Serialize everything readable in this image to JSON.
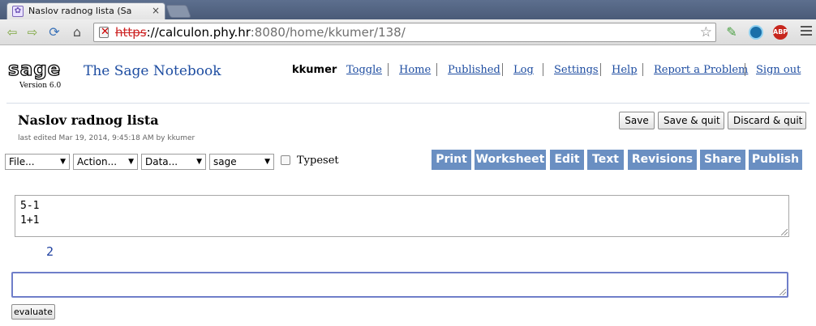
{
  "browser": {
    "tab_title": "Naslov radnog lista (Sa",
    "tab_close": "×",
    "url_scheme": "https",
    "url_sep": "://",
    "url_host": "calculon.phy.hr",
    "url_port": ":8080",
    "url_path": "/home/kkumer/138/",
    "extension_abp": "ABP"
  },
  "sage": {
    "logo_text": "sage",
    "version": "Version 6.0",
    "notebook_title": "The Sage Notebook",
    "username": "kkumer",
    "links": [
      "Toggle",
      "Home",
      "Published",
      "Log",
      "Settings",
      "Help",
      "Report a Problem",
      "Sign out"
    ]
  },
  "worksheet": {
    "name": "Naslov radnog lista",
    "last_edited": "last edited Mar 19, 2014, 9:45:18 AM by kkumer",
    "buttons": {
      "save": "Save",
      "save_quit": "Save & quit",
      "discard_quit": "Discard & quit"
    }
  },
  "controls": {
    "file_menu": "File...",
    "action_menu": "Action...",
    "data_menu": "Data...",
    "system_select": "sage",
    "typeset_label": "Typeset",
    "tabs": [
      "Print",
      "Worksheet",
      "Edit",
      "Text",
      "Revisions",
      "Share",
      "Publish"
    ]
  },
  "cells": {
    "cell1_lines": [
      "5-1",
      "1+1"
    ],
    "cell1_output": "2",
    "evaluate_label": "evaluate"
  }
}
